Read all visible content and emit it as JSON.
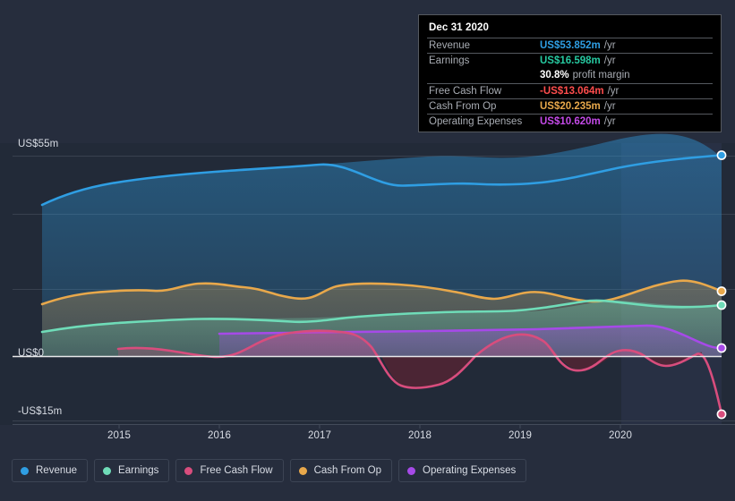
{
  "colors": {
    "background": "#262d3d",
    "plot_background": "#222a38",
    "revenue": "#2f9ee3",
    "earnings": "#6fdcb8",
    "free_cash_flow": "#d84d7d",
    "cash_from_op": "#e8a84b",
    "operating_expenses": "#a64ae8",
    "zero_line": "#e8e8ea",
    "gridline": "#39414f",
    "tooltip_bg": "#000000",
    "tooltip_border": "#55595f",
    "tooltip_label": "#a8acb3",
    "tooltip_negative": "#ff4d4d",
    "axis_text": "#d9dde5"
  },
  "tooltip": {
    "date": "Dec 31 2020",
    "rows": [
      {
        "label": "Revenue",
        "value": "US$53.852m",
        "unit": "/yr",
        "color": "#2f9ee3"
      },
      {
        "label": "Earnings",
        "value": "US$16.598m",
        "unit": "/yr",
        "color": "#6fdcb8"
      },
      {
        "label": "",
        "value": "30.8%",
        "unit": "profit margin",
        "color": "#ffffff"
      },
      {
        "label": "Free Cash Flow",
        "value": "-US$13.064m",
        "unit": "/yr",
        "color": "#ff4d4d"
      },
      {
        "label": "Cash From Op",
        "value": "US$20.235m",
        "unit": "/yr",
        "color": "#e8a84b"
      },
      {
        "label": "Operating Expenses",
        "value": "US$10.620m",
        "unit": "/yr",
        "color": "#c44ae8"
      }
    ]
  },
  "legend": {
    "items": [
      {
        "label": "Revenue",
        "color": "#2f9ee3"
      },
      {
        "label": "Earnings",
        "color": "#6fdcb8"
      },
      {
        "label": "Free Cash Flow",
        "color": "#d84d7d"
      },
      {
        "label": "Cash From Op",
        "color": "#e8a84b"
      },
      {
        "label": "Operating Expenses",
        "color": "#a64ae8"
      }
    ]
  },
  "chart_data": {
    "type": "area",
    "title": "",
    "xlabel": "",
    "ylabel": "",
    "ylim": [
      -15,
      55
    ],
    "y_ticks": [
      {
        "label": "US$55m",
        "value": 55
      },
      {
        "label": "US$0",
        "value": 0
      },
      {
        "label": "-US$15m",
        "value": -15
      }
    ],
    "gridlines": [
      55,
      35,
      15,
      0,
      -15
    ],
    "x_ticks": [
      "2015",
      "2016",
      "2017",
      "2018",
      "2019",
      "2020"
    ],
    "x_range": [
      "2014-07",
      "2021-03"
    ],
    "grid": true,
    "legend_position": "bottom",
    "units": "US$ millions per year",
    "series": [
      {
        "name": "Revenue",
        "color": "#2f9ee3",
        "x": [
          2014.55,
          2015.0,
          2015.3,
          2015.6,
          2016.0,
          2016.4,
          2016.8,
          2017.0,
          2017.3,
          2017.6,
          2018.0,
          2018.3,
          2018.6,
          2019.0,
          2019.3,
          2019.6,
          2020.0,
          2020.3,
          2020.6,
          2020.95
        ],
        "values": [
          38.9,
          41.8,
          43.1,
          43.9,
          44.9,
          45.3,
          45.6,
          46.0,
          46.4,
          46.6,
          47.0,
          47.6,
          47.9,
          47.6,
          47.5,
          48.8,
          50.4,
          51.6,
          52.8,
          53.852
        ]
      },
      {
        "name": "Earnings",
        "color": "#6fdcb8",
        "x": [
          2014.55,
          2015.0,
          2015.4,
          2015.8,
          2016.2,
          2016.6,
          2017.0,
          2017.4,
          2017.8,
          2018.2,
          2018.6,
          2019.0,
          2019.4,
          2019.8,
          2020.2,
          2020.6,
          2020.95
        ],
        "values": [
          6.5,
          7.4,
          8.1,
          8.8,
          9.3,
          9.6,
          9.6,
          9.7,
          10.2,
          10.8,
          11.3,
          11.6,
          11.8,
          12.3,
          14.1,
          15.6,
          16.598
        ]
      },
      {
        "name": "Free Cash Flow",
        "color": "#d84d7d",
        "x": [
          2015.25,
          2015.6,
          2016.0,
          2016.35,
          2016.7,
          2017.0,
          2017.3,
          2017.6,
          2017.9,
          2018.2,
          2018.5,
          2018.8,
          2019.1,
          2019.4,
          2019.7,
          2020.0,
          2020.3,
          2020.6,
          2020.8,
          2020.95
        ],
        "values": [
          -0.2,
          -0.7,
          -1.3,
          1.2,
          1.9,
          1.7,
          -1.1,
          -7.3,
          -7.4,
          -4.5,
          2.5,
          1.0,
          0.8,
          -0.6,
          -3.6,
          -1.6,
          -2.9,
          -1.0,
          -1.4,
          -13.064
        ]
      },
      {
        "name": "Cash From Op",
        "color": "#e8a84b",
        "x": [
          2014.55,
          2015.0,
          2015.4,
          2015.75,
          2016.0,
          2016.4,
          2016.75,
          2017.0,
          2017.4,
          2017.8,
          2018.2,
          2018.5,
          2018.8,
          2019.2,
          2019.6,
          2019.9,
          2020.2,
          2020.5,
          2020.75,
          2020.95
        ],
        "values": [
          18.3,
          20.4,
          21.4,
          20.8,
          22.6,
          21.9,
          20.7,
          22.6,
          22.5,
          22.8,
          21.3,
          22.5,
          22.1,
          21.1,
          20.0,
          19.2,
          20.2,
          19.3,
          22.2,
          20.235
        ]
      },
      {
        "name": "Operating Expenses",
        "color": "#a64ae8",
        "x": [
          2015.82,
          2016.2,
          2016.6,
          2017.0,
          2017.5,
          2018.0,
          2018.5,
          2019.0,
          2019.5,
          2020.0,
          2020.5,
          2020.95
        ],
        "values": [
          8.5,
          8.6,
          8.7,
          8.7,
          8.8,
          8.9,
          9.0,
          9.2,
          9.4,
          9.7,
          10.2,
          10.62
        ]
      }
    ],
    "highlight_band": {
      "from": "2020-01",
      "note": "lighter shaded recent period"
    }
  }
}
